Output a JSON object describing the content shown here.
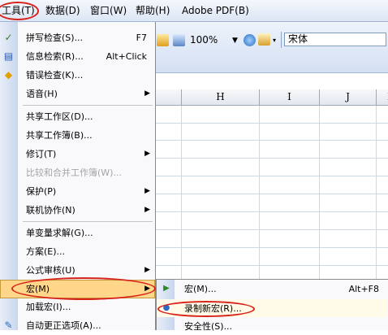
{
  "menubar": {
    "items": [
      {
        "label": "工具(T)"
      },
      {
        "label": "数据(D)"
      },
      {
        "label": "窗口(W)"
      },
      {
        "label": "帮助(H)"
      },
      {
        "label": "Adobe PDF(B)"
      }
    ]
  },
  "toolbar": {
    "zoom_value": "100%",
    "font_value": "宋体"
  },
  "grid": {
    "columns": [
      "H",
      "I",
      "J",
      "K"
    ]
  },
  "tools_menu": {
    "items": [
      {
        "label": "拼写检查(S)...",
        "shortcut": "F7"
      },
      {
        "label": "信息检索(R)...",
        "shortcut": "Alt+Click"
      },
      {
        "label": "错误检查(K)..."
      },
      {
        "label": "语音(H)"
      },
      {
        "label": "共享工作区(D)..."
      },
      {
        "label": "共享工作簿(B)..."
      },
      {
        "label": "修订(T)"
      },
      {
        "label": "比较和合并工作簿(W)..."
      },
      {
        "label": "保护(P)"
      },
      {
        "label": "联机协作(N)"
      },
      {
        "label": "单变量求解(G)..."
      },
      {
        "label": "方案(E)..."
      },
      {
        "label": "公式审核(U)"
      },
      {
        "label": "宏(M)"
      },
      {
        "label": "加载宏(I)..."
      },
      {
        "label": "自动更正选项(A)..."
      }
    ]
  },
  "macro_submenu": {
    "items": [
      {
        "label": "宏(M)...",
        "shortcut": "Alt+F8"
      },
      {
        "label": "录制新宏(R)..."
      },
      {
        "label": "安全性(S)..."
      }
    ]
  }
}
